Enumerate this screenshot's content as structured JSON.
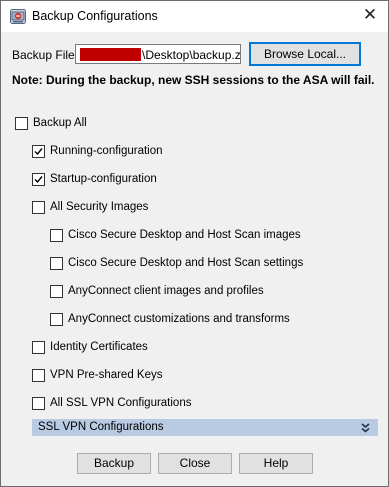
{
  "window": {
    "title": "Backup Configurations",
    "icons": {
      "app": "asdm-app-icon",
      "close": "close-icon"
    },
    "close_glyph": "✕"
  },
  "backup_file": {
    "label": "Backup File:",
    "path_visible": "\\Desktop\\backup.zip",
    "redacted_prefix": true,
    "redaction_color": "#c00000",
    "browse_button": "Browse Local..."
  },
  "note": "Note: During the backup, new SSH sessions to the ASA will fail.",
  "options": {
    "backup_all": {
      "label": "Backup All",
      "checked": false
    },
    "running_config": {
      "label": "Running-configuration",
      "checked": true
    },
    "startup_config": {
      "label": "Startup-configuration",
      "checked": true
    },
    "all_security_images": {
      "label": "All Security Images",
      "checked": false
    },
    "csd_hostscan_images": {
      "label": "Cisco Secure Desktop and Host Scan images",
      "checked": false
    },
    "csd_hostscan_settings": {
      "label": "Cisco Secure Desktop and Host Scan settings",
      "checked": false
    },
    "anyconnect_images": {
      "label": "AnyConnect client images and profiles",
      "checked": false
    },
    "anyconnect_customizations": {
      "label": "AnyConnect customizations and transforms",
      "checked": false
    },
    "identity_certificates": {
      "label": "Identity Certificates",
      "checked": false
    },
    "vpn_preshared_keys": {
      "label": "VPN Pre-shared Keys",
      "checked": false
    },
    "all_ssl_vpn_configs": {
      "label": "All SSL VPN Configurations",
      "checked": false
    }
  },
  "ssl_section": {
    "label": "SSL VPN Configurations",
    "icon": "double-chevron-down-icon",
    "expanded": false
  },
  "buttons": {
    "backup": "Backup",
    "close": "Close",
    "help": "Help"
  },
  "colors": {
    "accent_focus": "#0078d7",
    "section_bar": "#b9cbe2",
    "dialog_bg": "#f0f0f0"
  }
}
